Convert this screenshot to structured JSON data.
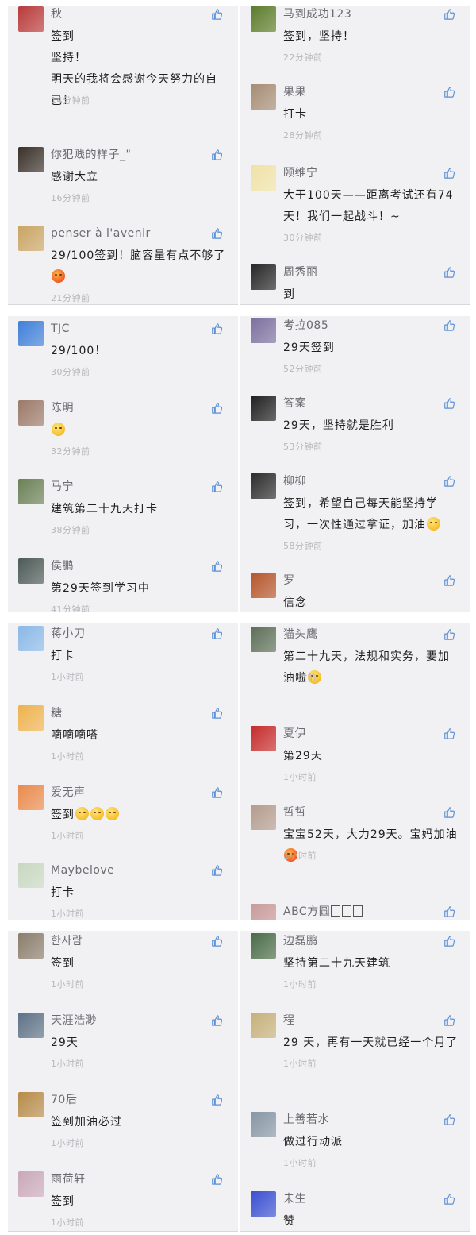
{
  "panels": [
    [
      {
        "name": "秋",
        "text": "签到\n坚持！\n明天的我将会感谢今天努力的自己！",
        "time": "14分钟前",
        "avatar": "#b93a3a"
      },
      {
        "name": "你犯贱的样子_\"",
        "text": "感谢大立",
        "time": "16分钟前",
        "avatar": "#3a3029"
      },
      {
        "name": "penser à l'avenir",
        "text": "29/100签到！脑容量有点不够了",
        "time": "21分钟前",
        "avatar": "#c9a463",
        "emoji": "red"
      }
    ],
    [
      {
        "name": "马到成功123",
        "text": "签到，坚持！",
        "time": "22分钟前",
        "avatar": "#5b7c2a"
      },
      {
        "name": "果果",
        "text": "打卡",
        "time": "28分钟前",
        "avatar": "#a58c74"
      },
      {
        "name": "颐维宁",
        "text": "大干100天——距离考试还有74天！我们一起战斗！~",
        "time": "30分钟前",
        "avatar": "#efe1a6"
      },
      {
        "name": "周秀丽",
        "text": "到",
        "time": "",
        "avatar": "#262626"
      }
    ],
    [
      {
        "name": "TJC",
        "text": "29/100！",
        "time": "30分钟前",
        "avatar": "#3f7fd8"
      },
      {
        "name": "陈明",
        "text": "",
        "time": "32分钟前",
        "avatar": "#9b7968",
        "emoji": "smile"
      },
      {
        "name": "马宁",
        "text": "建筑第二十九天打卡",
        "time": "38分钟前",
        "avatar": "#6a8056"
      },
      {
        "name": "侯鹏",
        "text": "第29天签到学习中",
        "time": "41分钟前",
        "avatar": "#4c5a56"
      }
    ],
    [
      {
        "name": "考拉085",
        "text": "29天签到",
        "time": "52分钟前",
        "avatar": "#7b6f9e"
      },
      {
        "name": "答案",
        "text": "29天，坚持就是胜利",
        "time": "53分钟前",
        "avatar": "#1f1f1f"
      },
      {
        "name": "柳柳",
        "text": "签到，希望自己每天能坚持学习，一次性通过拿证，加油",
        "time": "58分钟前",
        "avatar": "#2b2b2b",
        "emoji": "smile"
      },
      {
        "name": "罗",
        "text": "信念",
        "time": "",
        "avatar": "#b4552a"
      }
    ],
    [
      {
        "name": "蒋小刀",
        "text": "打卡",
        "time": "1小时前",
        "avatar": "#8ab8e6"
      },
      {
        "name": "糖",
        "text": "嘀嘀嘀嗒",
        "time": "1小时前",
        "avatar": "#eeb24e"
      },
      {
        "name": "爱无声",
        "text": "签到",
        "time": "1小时前",
        "avatar": "#e98a4c",
        "emoji": "smile3"
      },
      {
        "name": "Maybelove",
        "text": "打卡",
        "time": "1小时前",
        "avatar": "#c8d7c1"
      }
    ],
    [
      {
        "name": "猫头鹰",
        "text": "第二十九天，法规和实务，要加油啦",
        "time": "1小时前",
        "avatar": "#5c6e57",
        "emoji": "muscle"
      },
      {
        "name": "夏伊",
        "text": "第29天",
        "time": "1小时前",
        "avatar": "#c52b2b"
      },
      {
        "name": "哲哲",
        "text": "宝宝52天，大力29天。宝妈加油",
        "time": "1小时前",
        "avatar": "#b39b8d",
        "emoji": "red"
      },
      {
        "name": "ABC方圆",
        "text": "",
        "time": "",
        "avatar": "#c89a9a",
        "boxes": 3
      }
    ],
    [
      {
        "name": "한사람",
        "text": "签到",
        "time": "1小时前",
        "avatar": "#8a7d6b"
      },
      {
        "name": "天涯浩渺",
        "text": "29天",
        "time": "1小时前",
        "avatar": "#5d7185"
      },
      {
        "name": "70后",
        "text": "签到加油必过",
        "time": "1小时前",
        "avatar": "#b78b49"
      },
      {
        "name": "雨荷轩",
        "text": "签到",
        "time": "1小时前",
        "avatar": "#c9a8b8"
      }
    ],
    [
      {
        "name": "边磊鹏",
        "text": "坚持第二十九天建筑",
        "time": "1小时前",
        "avatar": "#4a6b47"
      },
      {
        "name": "程",
        "text": "29 天，再有一天就已经一个月了",
        "time": "1小时前",
        "avatar": "#c5b07a"
      },
      {
        "name": "上善若水",
        "text": "做过行动派",
        "time": "1小时前",
        "avatar": "#8696a4"
      },
      {
        "name": "未生",
        "text": "赞",
        "time": "",
        "avatar": "#3a4fd1"
      }
    ]
  ]
}
